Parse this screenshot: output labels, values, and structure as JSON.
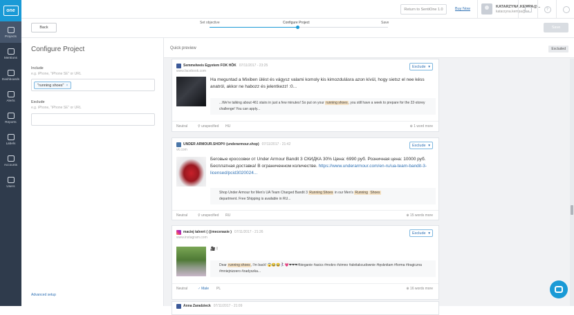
{
  "sidebar": {
    "logo": "one",
    "items": [
      {
        "label": "Projects",
        "icon": "projects-icon",
        "active": true
      },
      {
        "label": "Mentions",
        "icon": "mentions-icon"
      },
      {
        "label": "Dashboards",
        "icon": "dashboards-icon"
      },
      {
        "label": "Alerts",
        "icon": "alerts-icon"
      },
      {
        "label": "Reports",
        "icon": "reports-icon"
      },
      {
        "label": "Labels",
        "icon": "labels-icon"
      },
      {
        "label": "Accounts",
        "icon": "accounts-icon"
      },
      {
        "label": "Users",
        "icon": "users-icon"
      }
    ]
  },
  "topbar": {
    "return_label": "Return to SentiOne 1.0",
    "buy_now": "Buy Now",
    "user_name": "KATARZYNA.KEMPA@...",
    "user_email": "katarzyna.kempa@se..."
  },
  "steps": {
    "back": "Back",
    "items": [
      "Set objective",
      "Configure Project",
      "Save"
    ],
    "save": "Save"
  },
  "config": {
    "title": "Configure Project",
    "include_label": "Include",
    "include_hint": "e.g. iPhone, \"iPhone SE\" or URL",
    "include_chip": "\"running shoes\"",
    "chip_remove": "×",
    "exclude_label": "Exclude",
    "exclude_hint": "e.g. iPhone, \"iPhone SE\" or URL",
    "advanced": "Advanced setup"
  },
  "preview": {
    "title": "Quick preview",
    "excluded": "Excluded",
    "dropdown_label": "Exclude",
    "cards": [
      {
        "source": "Semmelweis Egyetem FOK HÖK",
        "date": "07/11/2017 - 23:25",
        "domain": "www.facebook.com",
        "post": "Ha meguntad a Mixiben ülést és vágysz valami komoly kis kimozdulásra azon kívül, hogy sietsz el nee késs anatról, akkor ne habozz és jelentkezz! :0...",
        "snippet_pre": "...We're talking about 461 stairs in just a few minutes! So put on your ",
        "snippet_hl": "running shoes",
        "snippet_post": ", you still have a week to prepare for the 22-storey challenge! You can apply...",
        "sentiment": "Neutral",
        "gender": "unspecified",
        "lang": "HU",
        "more": "1 word more"
      },
      {
        "source": "UNDER ARMOUR.SHOP® (underarmour.shop)",
        "date": "07/11/2017 - 21:42",
        "domain": "vk.com",
        "post": "Беговые кроссовки от Under Armour Bandit 3 СКИДКА 30% Цена: 6990 руб. Розничная цена: 10000 руб. Бесплатная доставка! В ограниченном количестве. ",
        "post_link": "https://www.underarmour.com/en-ru/ua-team-bandit-3-licensed/pcid3020024...",
        "snippet_pre": "Shop Under Armour for Men's UA Team Charged Bandit 3 ",
        "snippet_hl": "Running Shoes",
        "snippet_mid": " in our Men's ",
        "snippet_hl2": "Running",
        "snippet_hl3": "Shoes",
        "snippet_post": "department. Free Shipping is available in RU...",
        "sentiment": "Neutral",
        "gender": "unspecified",
        "lang": "RU",
        "more": "15 words more"
      },
      {
        "source": "maciej talvert ( @mecenasie )",
        "date": "07/11/2017 - 21:26",
        "domain": "www.instagram.com",
        "post": "🎥 !",
        "snippet_pre": "Dear ",
        "snippet_hl": "running shoes",
        "snippet_post": ", I'm back! 😱😂😂🏃🏻‍♀️💗❤❤❤#bieganie #asics #mokro #zimno #aleitakcudownie #tęsknitam #forma #tragiczna #mniejnizzero #zadyszka...",
        "sentiment": "Neutral",
        "gender": "Male",
        "lang": "PL",
        "more": "16 words more"
      },
      {
        "source": "Anna Zaradzieck",
        "date": "07/11/2017 - 21:09"
      }
    ]
  },
  "colors": {
    "sidebar": "#2f3b4c",
    "accent": "#1a9ad6",
    "link": "#2c6fb3",
    "highlight": "#f6e2c3"
  }
}
